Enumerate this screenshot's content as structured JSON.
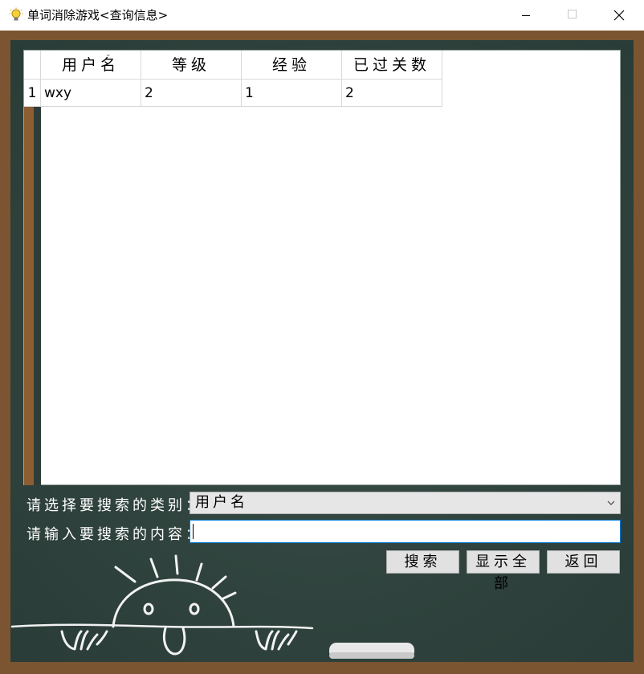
{
  "window": {
    "title": "单词消除游戏<查询信息>",
    "icons": [
      "lightbulb-icon",
      "minimize-icon",
      "maximize-icon",
      "close-icon"
    ]
  },
  "table": {
    "columns": [
      "用户名",
      "等级",
      "经验",
      "已过关数"
    ],
    "rows": [
      {
        "index": "1",
        "cells": [
          "wxy",
          "2",
          "1",
          "2"
        ]
      }
    ]
  },
  "form": {
    "category_label": "请选择要搜索的类别：",
    "category_selected": "用户名",
    "content_label": "请输入要搜索的内容：",
    "content_value": ""
  },
  "buttons": {
    "search": "搜索",
    "show_all": "显示全部",
    "back": "返回"
  },
  "colors": {
    "frame": "#7b5531",
    "board": "#2f423d",
    "chalk": "#ffffff",
    "input_focus": "#0078d7"
  }
}
